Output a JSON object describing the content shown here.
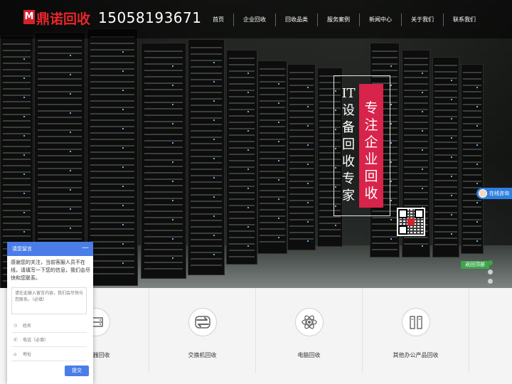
{
  "header": {
    "logo_mark": "M",
    "logo_text": "鼎诺回收",
    "phone": "15058193671",
    "nav": [
      "首页",
      "企业回收",
      "回收品类",
      "服务案例",
      "新闻中心",
      "关于我们",
      "联系我们"
    ]
  },
  "hero": {
    "slogan_left": "IT设备回收专家",
    "slogan_right": "专注企业回收"
  },
  "side": {
    "consult_label": "在线咨询",
    "back_to_top": "返回顶部"
  },
  "categories": [
    {
      "label": "服务器回收",
      "icon": "server-icon"
    },
    {
      "label": "交换机回收",
      "icon": "switch-icon"
    },
    {
      "label": "电脑回收",
      "icon": "computer-icon"
    },
    {
      "label": "其他办公产品回收",
      "icon": "office-icon"
    }
  ],
  "chat": {
    "title": "请您留言",
    "minimize": "—",
    "message": "感谢您的关注，当前客服人员不在线，请填写一下您的信息，我们会尽快和您联系。",
    "textarea_placeholder": "请在此输入留言内容，我们会尽快与您联系。（必填）",
    "name_placeholder": "姓名",
    "phone_placeholder": "电话（必填）",
    "address_placeholder": "地址",
    "submit": "提交"
  },
  "colors": {
    "brand_red": "#d4222a",
    "accent_pink": "#d8234b",
    "chat_blue": "#4a7de8",
    "green": "#3ba64a"
  }
}
